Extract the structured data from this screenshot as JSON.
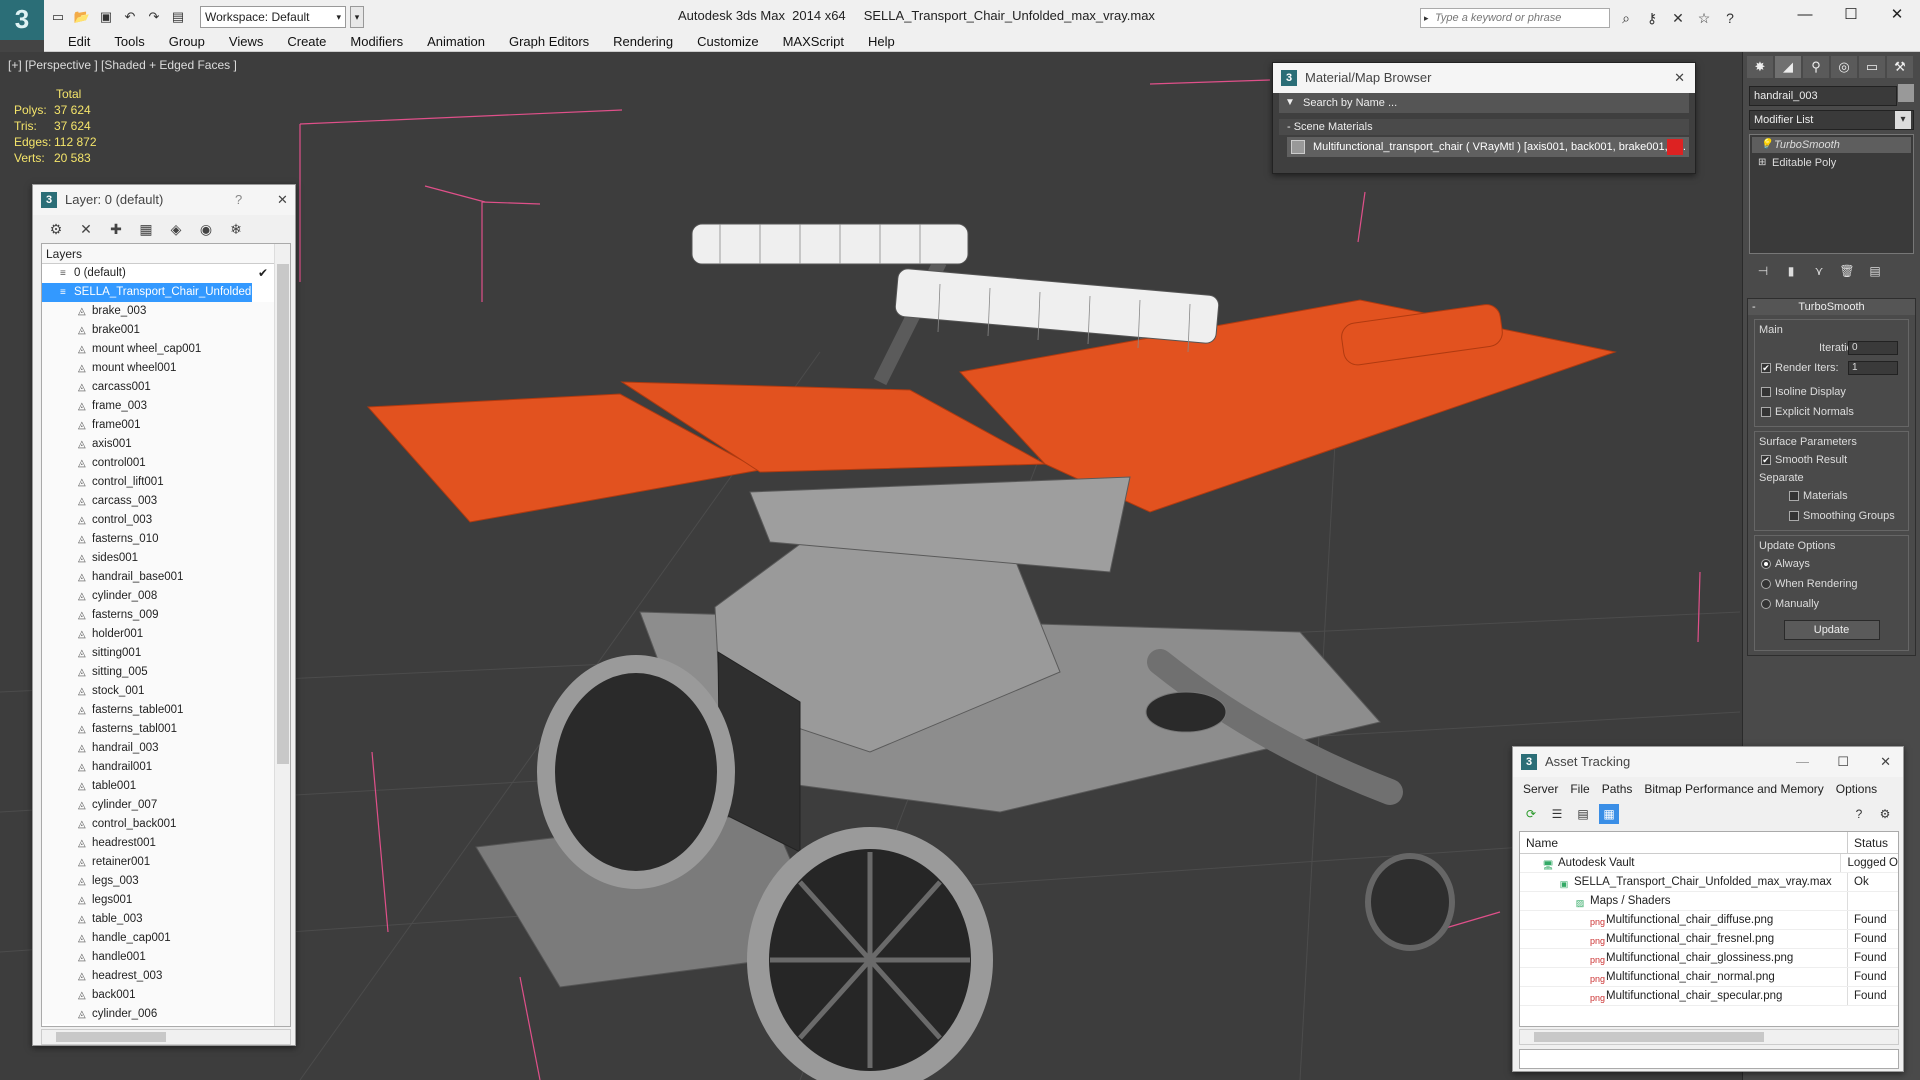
{
  "app": {
    "logo": "3",
    "title": "Autodesk 3ds Max  2014 x64     SELLA_Transport_Chair_Unfolded_max_vray.max",
    "workspace": "Workspace: Default",
    "search_placeholder": "Type a keyword or phrase"
  },
  "menu": [
    "Edit",
    "Tools",
    "Group",
    "Views",
    "Create",
    "Modifiers",
    "Animation",
    "Graph Editors",
    "Rendering",
    "Customize",
    "MAXScript",
    "Help"
  ],
  "viewport": {
    "label": "[+] [Perspective ] [Shaded + Edged Faces ]",
    "stats": {
      "header": "Total",
      "rows": [
        {
          "label": "Polys:",
          "value": "37 624"
        },
        {
          "label": "Tris:",
          "value": "37 624"
        },
        {
          "label": "Edges:",
          "value": "112 872"
        },
        {
          "label": "Verts:",
          "value": "20 583"
        }
      ]
    }
  },
  "layer_window": {
    "title": "Layer: 0 (default)",
    "help": "?",
    "header": "Layers",
    "default_layer": "0 (default)",
    "selected_layer": "SELLA_Transport_Chair_Unfolded",
    "objects": [
      "brake_003",
      "brake001",
      "mount wheel_cap001",
      "mount wheel001",
      "carcass001",
      "frame_003",
      "frame001",
      "axis001",
      "control001",
      "control_lift001",
      "carcass_003",
      "control_003",
      "fasterns_010",
      "sides001",
      "handrail_base001",
      "cylinder_008",
      "fasterns_009",
      "holder001",
      "sitting001",
      "sitting_005",
      "stock_001",
      "fasterns_table001",
      "fasterns_tabl001",
      "handrail_003",
      "handrail001",
      "table001",
      "cylinder_007",
      "control_back001",
      "headrest001",
      "retainer001",
      "legs_003",
      "legs001",
      "table_003",
      "handle_cap001",
      "handle001",
      "headrest_003",
      "back001",
      "cylinder_006"
    ]
  },
  "material_browser": {
    "title": "Material/Map Browser",
    "search": "Search by Name ...",
    "group": "- Scene Materials",
    "item": "Multifunctional_transport_chair  ( VRayMtl )  [axis001, back001, brake001, b..."
  },
  "command_panel": {
    "object_name": "handrail_003",
    "modifier_list": "Modifier List",
    "stack": [
      "TurboSmooth",
      "Editable Poly"
    ],
    "rollout": "TurboSmooth",
    "main_label": "Main",
    "iterations_label": "Iterations:",
    "iterations": "0",
    "render_iters_label": "Render Iters:",
    "render_iters": "1",
    "isoline": "Isoline Display",
    "explicit_normals": "Explicit Normals",
    "surface_params": "Surface Parameters",
    "smooth_result": "Smooth Result",
    "separate": "Separate",
    "materials": "Materials",
    "smoothing_groups": "Smoothing Groups",
    "update_options": "Update Options",
    "always": "Always",
    "when_rendering": "When Rendering",
    "manually": "Manually",
    "update": "Update"
  },
  "asset_tracking": {
    "title": "Asset Tracking",
    "menu": [
      "Server",
      "File",
      "Paths",
      "Bitmap Performance and Memory",
      "Options"
    ],
    "col_name": "Name",
    "col_status": "Status",
    "rows": [
      {
        "name": "Autodesk Vault",
        "status": "Logged O",
        "indent": 22
      },
      {
        "name": "SELLA_Transport_Chair_Unfolded_max_vray.max",
        "status": "Ok",
        "indent": 38
      },
      {
        "name": "Maps / Shaders",
        "status": "",
        "indent": 54
      },
      {
        "name": "Multifunctional_chair_diffuse.png",
        "status": "Found",
        "indent": 70
      },
      {
        "name": "Multifunctional_chair_fresnel.png",
        "status": "Found",
        "indent": 70
      },
      {
        "name": "Multifunctional_chair_glossiness.png",
        "status": "Found",
        "indent": 70
      },
      {
        "name": "Multifunctional_chair_normal.png",
        "status": "Found",
        "indent": 70
      },
      {
        "name": "Multifunctional_chair_specular.png",
        "status": "Found",
        "indent": 70
      }
    ]
  },
  "colors": {
    "seat_orange": "#e2521f",
    "frame_gray": "#8a8a8a",
    "selection_blue": "#3399ff",
    "stats_yellow": "#f4e46a"
  }
}
